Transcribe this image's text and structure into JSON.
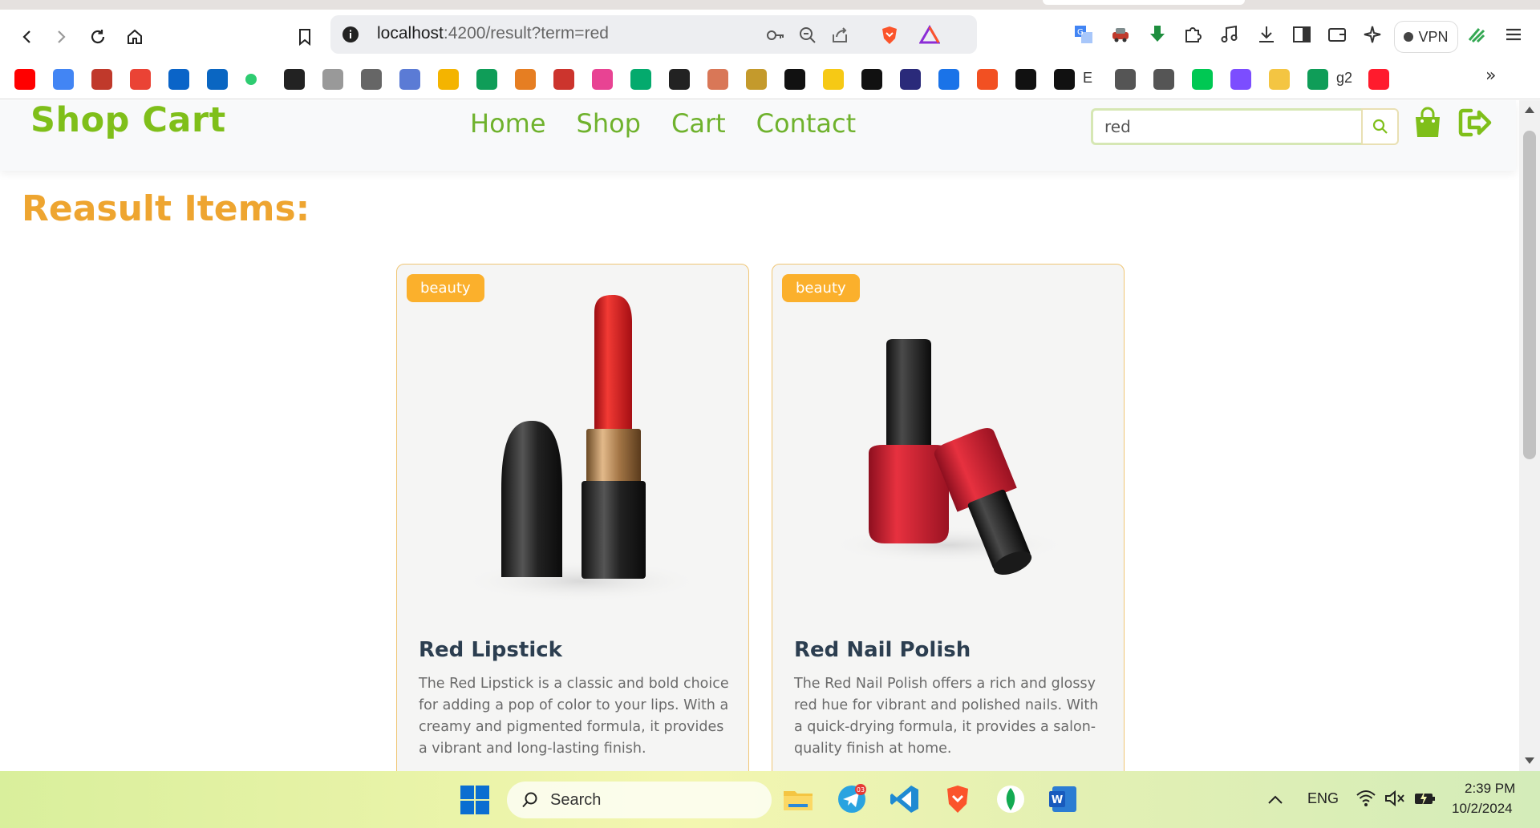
{
  "browser": {
    "url_host": "localhost",
    "url_rest": ":4200/result?term=red",
    "vpn_label": "VPN",
    "bookmarks": [
      {
        "icon": "youtube-icon",
        "color": "#ff0000"
      },
      {
        "icon": "translate-icon",
        "color": "#4285f4"
      },
      {
        "icon": "university-icon",
        "color": "#c0392b"
      },
      {
        "icon": "gmail-icon",
        "color": "#ea4335"
      },
      {
        "icon": "outlook-icon",
        "color": "#0a64c8"
      },
      {
        "icon": "linkedin-icon",
        "color": "#0a66c2"
      },
      {
        "icon": "green-dot-icon",
        "color": "#2ecc71"
      },
      {
        "icon": "notion-icon",
        "color": "#222222"
      },
      {
        "icon": "stack-icon",
        "color": "#999999"
      },
      {
        "icon": "qr-icon",
        "color": "#666666"
      },
      {
        "icon": "clipboard-icon",
        "color": "#5b7bd5"
      },
      {
        "icon": "bar-chart-icon",
        "color": "#f4b400"
      },
      {
        "icon": "drive-icon",
        "color": "#0f9d58"
      },
      {
        "icon": "torch-icon",
        "color": "#e67e22"
      },
      {
        "icon": "ruby-icon",
        "color": "#cc342d"
      },
      {
        "icon": "party-icon",
        "color": "#e84393"
      },
      {
        "icon": "w3-icon",
        "color": "#04aa6d"
      },
      {
        "icon": "openai-icon",
        "color": "#222222"
      },
      {
        "icon": "claude-icon",
        "color": "#d97757"
      },
      {
        "icon": "crown-icon",
        "color": "#c49a2c"
      },
      {
        "icon": "n-logo-icon",
        "color": "#111111"
      },
      {
        "icon": "note-icon",
        "color": "#f6c915"
      },
      {
        "icon": "github-icon",
        "color": "#111111"
      },
      {
        "icon": "apps-icon",
        "color": "#2a2a7a"
      },
      {
        "icon": "c-logo-icon",
        "color": "#1a73e8"
      },
      {
        "icon": "microsoft-icon",
        "color": "#f25022"
      },
      {
        "icon": "angular-icon",
        "color": "#111111"
      },
      {
        "icon": "angular-e-icon",
        "color": "#111111",
        "label": "E"
      },
      {
        "icon": "cisco-icon",
        "color": "#555555"
      },
      {
        "icon": "cisco2-icon",
        "color": "#555555"
      },
      {
        "icon": "rk-icon",
        "color": "#00c853"
      },
      {
        "icon": "u-logo-icon",
        "color": "#7c4dff"
      },
      {
        "icon": "folder-icon",
        "color": "#f4c542"
      },
      {
        "icon": "drive2-icon",
        "color": "#0f9d58",
        "label": "g2"
      },
      {
        "icon": "opera-icon",
        "color": "#ff1b2d"
      }
    ]
  },
  "site": {
    "brand": "Shop Cart",
    "nav": [
      "Home",
      "Shop",
      "Cart",
      "Contact"
    ],
    "search_value": "red",
    "result_heading": "Reasult Items:",
    "colors": {
      "brand": "#7fbf1a",
      "accent": "#eea530",
      "badge": "#fbb02c"
    },
    "products": [
      {
        "category": "beauty",
        "name": "Red Lipstick",
        "description": "The Red Lipstick is a classic and bold choice for adding a pop of color to your lips. With a creamy and pigmented formula, it provides a vibrant and long-lasting finish."
      },
      {
        "category": "beauty",
        "name": "Red Nail Polish",
        "description": "The Red Nail Polish offers a rich and glossy red hue for vibrant and polished nails. With a quick-drying formula, it provides a salon-quality finish at home."
      }
    ]
  },
  "taskbar": {
    "search_label": "Search",
    "language": "ENG",
    "time": "2:39 PM",
    "date": "10/2/2024",
    "telegram_badge": "03"
  }
}
